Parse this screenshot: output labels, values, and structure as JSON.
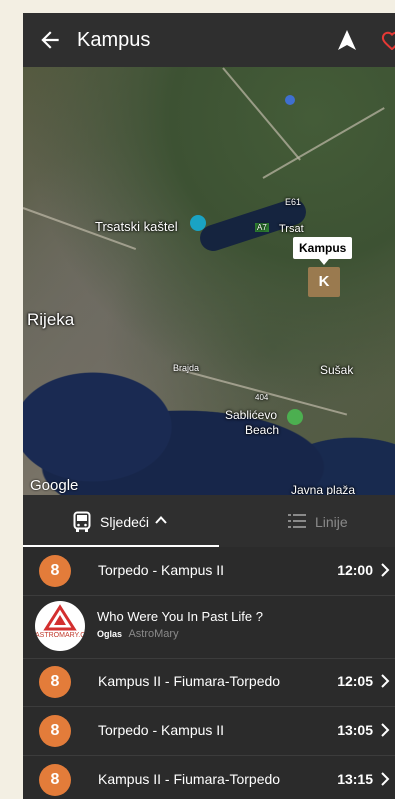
{
  "header": {
    "title": "Kampus"
  },
  "map": {
    "attribution": "Google",
    "labels": {
      "trsatski_kastel": "Trsatski kaštel",
      "trsat": "Trsat",
      "rijeka": "Rijeka",
      "susak": "Sušak",
      "sablicevo": "Sablićevo",
      "beach": "Beach",
      "e61": "E61",
      "a7": "A7",
      "brajda": "Brajda",
      "javna_plaza": "Javna plaža",
      "r404": "404"
    },
    "marker_label": "Kampus",
    "marker_letter": "K"
  },
  "tabs": {
    "next": "Sljedeći",
    "lines": "Linije"
  },
  "departures": [
    {
      "line": "8",
      "route": "Torpedo - Kampus II",
      "time": "12:00"
    },
    {
      "line": "8",
      "route": "Kampus II - Fiumara-Torpedo",
      "time": "12:05"
    },
    {
      "line": "8",
      "route": "Torpedo - Kampus II",
      "time": "13:05"
    },
    {
      "line": "8",
      "route": "Kampus II - Fiumara-Torpedo",
      "time": "13:15"
    }
  ],
  "ad": {
    "headline": "Who Were You In Past Life ?",
    "label": "Oglas",
    "advertiser": "AstroMary",
    "logo_text": "ASTROMARY.COM"
  },
  "colors": {
    "accent": "#e37c3a",
    "header_bg": "#2f2f2f",
    "favorite": "#e53935"
  }
}
